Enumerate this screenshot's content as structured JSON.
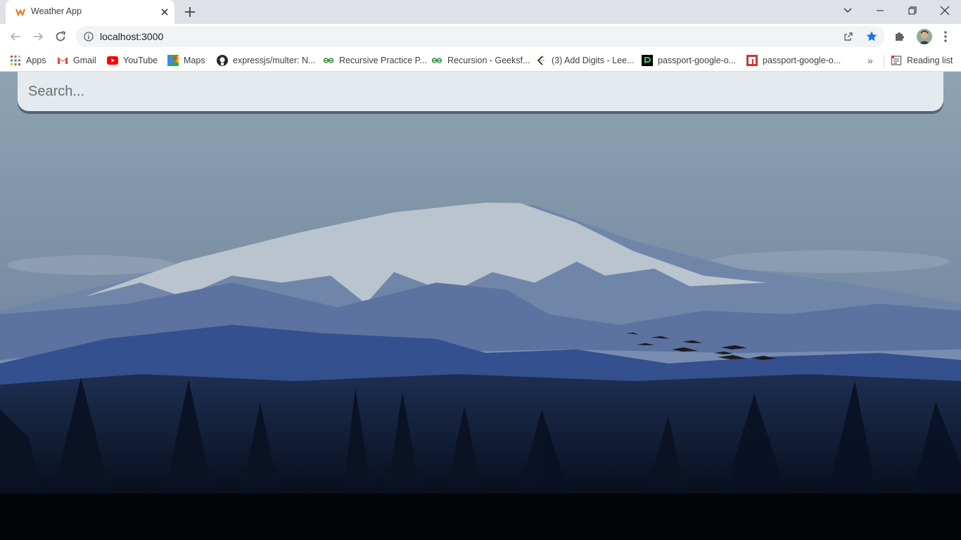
{
  "tab": {
    "title": "Weather App",
    "favicon": "weather-app-favicon"
  },
  "toolbar": {
    "url": "localhost:3000"
  },
  "bookmarks": [
    {
      "label": "Apps",
      "icon": "apps-grid-icon"
    },
    {
      "label": "Gmail",
      "icon": "gmail-icon"
    },
    {
      "label": "YouTube",
      "icon": "youtube-icon"
    },
    {
      "label": "Maps",
      "icon": "maps-icon"
    },
    {
      "label": "expressjs/multer: N...",
      "icon": "github-icon"
    },
    {
      "label": "Recursive Practice P...",
      "icon": "geeksforgeeks-icon"
    },
    {
      "label": "Recursion - Geeksf...",
      "icon": "geeksforgeeks-icon"
    },
    {
      "label": "(3) Add Digits - Lee...",
      "icon": "leetcode-icon"
    },
    {
      "label": "passport-google-o...",
      "icon": "passport-icon"
    },
    {
      "label": "passport-google-o...",
      "icon": "npm-icon"
    }
  ],
  "reading_list": {
    "label": "Reading list",
    "icon": "reading-list-icon"
  },
  "search": {
    "placeholder": "Search..."
  },
  "colors": {
    "accent_star": "#1a73e8",
    "search_bg": "#ecf0f3"
  }
}
